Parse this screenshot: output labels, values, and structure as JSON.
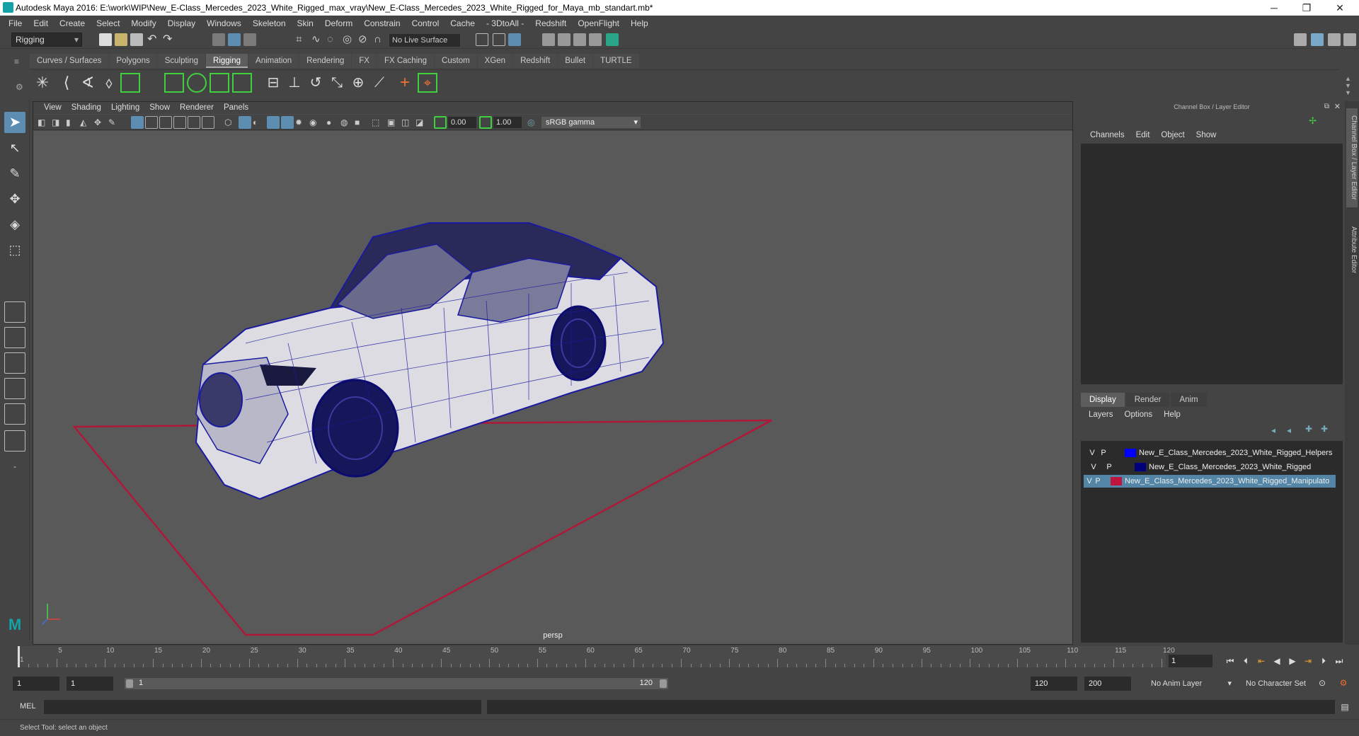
{
  "window": {
    "title": "Autodesk Maya 2016: E:\\work\\WIP\\New_E-Class_Mercedes_2023_White_Rigged_max_vray\\New_E-Class_Mercedes_2023_White_Rigged_for_Maya_mb_standart.mb*",
    "minimize": "─",
    "restore": "❐",
    "close": "✕"
  },
  "menubar": [
    "File",
    "Edit",
    "Create",
    "Select",
    "Modify",
    "Display",
    "Windows",
    "Skeleton",
    "Skin",
    "Deform",
    "Constrain",
    "Control",
    "Cache",
    "- 3DtoAll -",
    "Redshift",
    "OpenFlight",
    "Help"
  ],
  "statusline": {
    "mode": "Rigging",
    "live_surface": "No Live Surface"
  },
  "shelf": {
    "tabs": [
      "Curves / Surfaces",
      "Polygons",
      "Sculpting",
      "Rigging",
      "Animation",
      "Rendering",
      "FX",
      "FX Caching",
      "Custom",
      "XGen",
      "Redshift",
      "Bullet",
      "TURTLE"
    ],
    "active_tab": "Rigging"
  },
  "viewport": {
    "menu": [
      "View",
      "Shading",
      "Lighting",
      "Show",
      "Renderer",
      "Panels"
    ],
    "exposure": "0.00",
    "gamma": "1.00",
    "color_space": "sRGB gamma",
    "camera_label": "persp"
  },
  "channel_box": {
    "title": "Channel Box / Layer Editor",
    "menu": [
      "Channels",
      "Edit",
      "Object",
      "Show"
    ]
  },
  "layer_editor": {
    "tabs": [
      "Display",
      "Render",
      "Anim"
    ],
    "active_tab": "Display",
    "menu": [
      "Layers",
      "Options",
      "Help"
    ],
    "layers": [
      {
        "v": "V",
        "p": "P",
        "color": "#0000ff",
        "name": "New_E_Class_Mercedes_2023_White_Rigged_Helpers",
        "selected": false
      },
      {
        "v": "V",
        "p": "P",
        "color": "#00007a",
        "name": "New_E_Class_Mercedes_2023_White_Rigged",
        "selected": false
      },
      {
        "v": "V",
        "p": "P",
        "color": "#c0143c",
        "name": "New_E_Class_Mercedes_2023_White_Rigged_Manipulato",
        "selected": true
      }
    ]
  },
  "side_tabs": [
    "Channel Box / Layer Editor",
    "Attribute Editor"
  ],
  "timeline": {
    "ticks": [
      "1",
      "5",
      "10",
      "15",
      "20",
      "25",
      "30",
      "35",
      "40",
      "45",
      "50",
      "55",
      "60",
      "65",
      "70",
      "75",
      "80",
      "85",
      "90",
      "95",
      "100",
      "105",
      "110",
      "115",
      "120"
    ],
    "current_frame": "1"
  },
  "range": {
    "start": "1",
    "inner_start": "1",
    "slider_start": "1",
    "slider_end": "120",
    "end": "120",
    "max": "200",
    "anim_layer": "No Anim Layer",
    "character_set": "No Character Set"
  },
  "command_line": {
    "label": "MEL"
  },
  "help_line": "Select Tool: select an object",
  "colors": {
    "accent": "#5285a6",
    "wire": "#1a1aa0",
    "grid_red": "#b0183a",
    "helper_blue": "#0000ff"
  }
}
